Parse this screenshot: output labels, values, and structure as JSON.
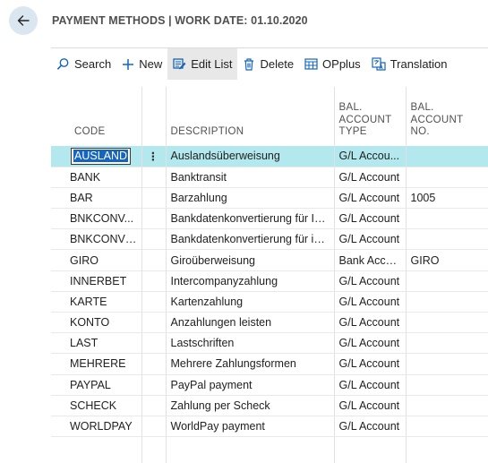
{
  "page": {
    "title": "PAYMENT METHODS | WORK DATE: 01.10.2020"
  },
  "actions": [
    {
      "label": "Search",
      "icon": "search-icon"
    },
    {
      "label": "New",
      "icon": "plus-icon"
    },
    {
      "label": "Edit List",
      "icon": "edit-list-icon",
      "active": true
    },
    {
      "label": "Delete",
      "icon": "trash-icon"
    },
    {
      "label": "OPplus",
      "icon": "opplus-icon"
    },
    {
      "label": "Translation",
      "icon": "translation-icon"
    }
  ],
  "columns": {
    "code": "CODE",
    "description": "DESCRIPTION",
    "bal_type": [
      "BAL.",
      "ACCOUNT",
      "TYPE"
    ],
    "bal_no": [
      "BAL.",
      "ACCOUNT",
      "NO."
    ]
  },
  "rows": [
    {
      "code": "AUSLAND",
      "description": "Auslandsüberweisung",
      "bal_type": "G/L Accou...",
      "bal_no": ""
    },
    {
      "code": "BANK",
      "description": "Banktransit",
      "bal_type": "G/L Account",
      "bal_no": ""
    },
    {
      "code": "BAR",
      "description": "Barzahlung",
      "bal_type": "G/L Account",
      "bal_no": "1005"
    },
    {
      "code": "BNKCONV...",
      "description": "Bankdatenkonvertierung für In...",
      "bal_type": "G/L Account",
      "bal_no": ""
    },
    {
      "code": "BNKCONVI...",
      "description": "Bankdatenkonvertierung für in...",
      "bal_type": "G/L Account",
      "bal_no": ""
    },
    {
      "code": "GIRO",
      "description": "Giroüberweisung",
      "bal_type": "Bank Accou...",
      "bal_no": "GIRO"
    },
    {
      "code": "INNERBET",
      "description": "Intercompanyzahlung",
      "bal_type": "G/L Account",
      "bal_no": ""
    },
    {
      "code": "KARTE",
      "description": "Kartenzahlung",
      "bal_type": "G/L Account",
      "bal_no": ""
    },
    {
      "code": "KONTO",
      "description": "Anzahlungen leisten",
      "bal_type": "G/L Account",
      "bal_no": ""
    },
    {
      "code": "LAST",
      "description": "Lastschriften",
      "bal_type": "G/L Account",
      "bal_no": ""
    },
    {
      "code": "MEHRERE",
      "description": "Mehrere Zahlungsformen",
      "bal_type": "G/L Account",
      "bal_no": ""
    },
    {
      "code": "PAYPAL",
      "description": "PayPal payment",
      "bal_type": "G/L Account",
      "bal_no": ""
    },
    {
      "code": "SCHECK",
      "description": "Zahlung per Scheck",
      "bal_type": "G/L Account",
      "bal_no": ""
    },
    {
      "code": "WORLDPAY",
      "description": "WorldPay payment",
      "bal_type": "G/L Account",
      "bal_no": ""
    }
  ],
  "row_menu_glyph": "⋮",
  "colors": {
    "selected_row": "#b3e9ee",
    "back_button_bg": "#dbe7f0",
    "accent": "#1565c0"
  }
}
